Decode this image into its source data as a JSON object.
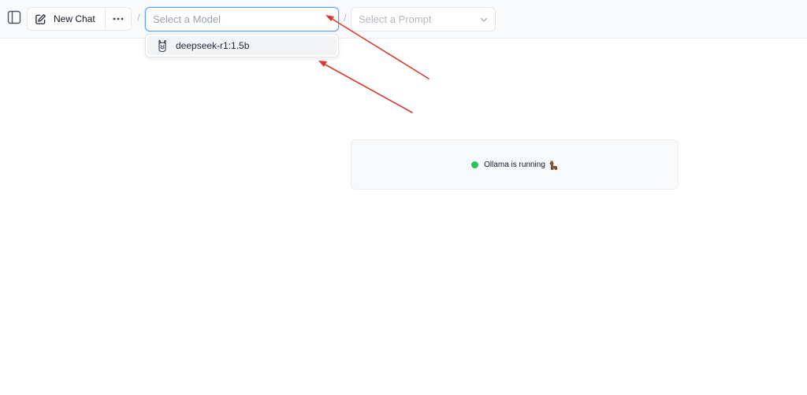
{
  "header": {
    "new_chat_label": "New Chat",
    "separator": "/",
    "model_select_placeholder": "Select a Model",
    "prompt_select_placeholder": "Select a Prompt"
  },
  "model_dropdown": {
    "items": [
      {
        "label": "deepseek-r1:1.5b",
        "icon": "ollama-llama-icon"
      }
    ]
  },
  "status": {
    "text": "Ollama is running",
    "emoji_icon": "llama-emoji-icon",
    "dot_color": "#22c55e"
  },
  "annotations": {
    "arrow_color": "#d93a2b"
  }
}
